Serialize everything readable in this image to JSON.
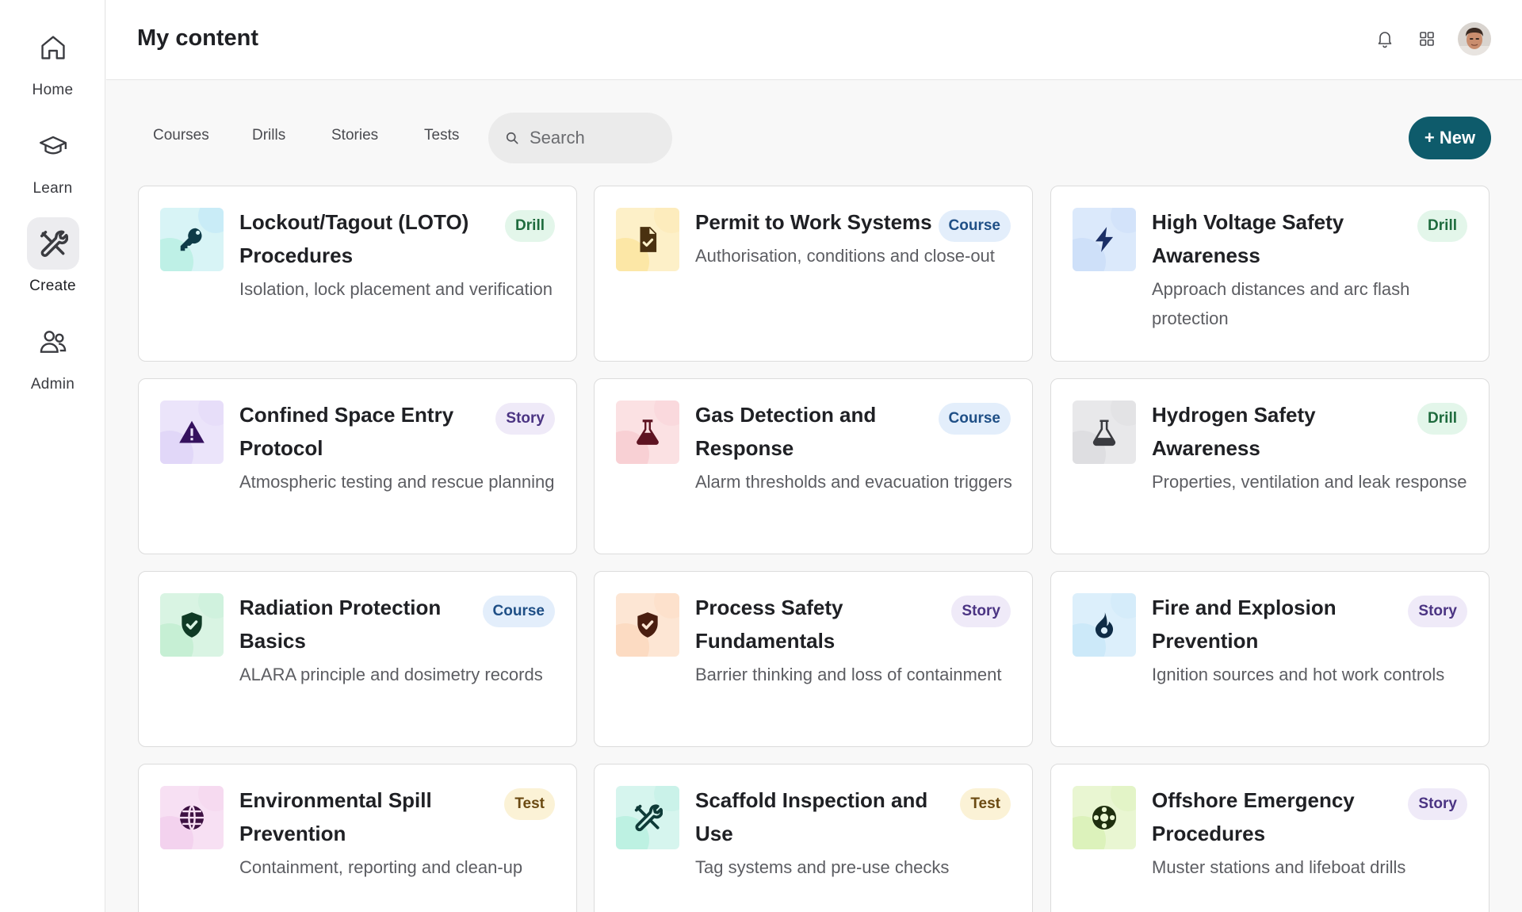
{
  "sidebar": {
    "items": [
      {
        "label": "Home",
        "icon": "home-icon",
        "active": false
      },
      {
        "label": "Learn",
        "icon": "graduation-cap-icon",
        "active": false
      },
      {
        "label": "Create",
        "icon": "tools-icon",
        "active": true
      },
      {
        "label": "Admin",
        "icon": "users-icon",
        "active": false
      }
    ]
  },
  "header": {
    "title": "My content",
    "icons": [
      "bell-icon",
      "grid-icon"
    ]
  },
  "toolbar": {
    "tabs": [
      "Courses",
      "Drills",
      "Stories",
      "Tests"
    ],
    "search_placeholder": "Search",
    "new_label": "+ New"
  },
  "colors": {
    "accent": "#0e5b6b",
    "drill": "#1e6b3d",
    "course": "#1f4f86",
    "story": "#4b3483",
    "test": "#6b4a12"
  },
  "cards": [
    {
      "title": "Lockout/Tagout (LOTO) Procedures",
      "desc": "Isolation, lock placement and verification",
      "badge": "Drill",
      "icon": "key-icon",
      "bg": "#d8f4f6",
      "blob1": "#a9ecd9",
      "blob2": "#b9e3f8",
      "fg": "#0f3b48"
    },
    {
      "title": "Permit to Work Systems",
      "desc": "Authorisation, conditions and close-out",
      "badge": "Course",
      "icon": "document-check-icon",
      "bg": "#fdf0c8",
      "blob1": "#fbe08a",
      "blob2": "#fde6b0",
      "fg": "#4a3110"
    },
    {
      "title": "High Voltage Safety Awareness",
      "desc": "Approach distances and arc flash protection",
      "badge": "Drill",
      "icon": "lightning-icon",
      "bg": "#dbe9fb",
      "blob1": "#c2d9f7",
      "blob2": "#c9dcf8",
      "fg": "#1b2f66"
    },
    {
      "title": "Confined Space Entry Protocol",
      "desc": "Atmospheric testing and rescue planning",
      "badge": "Story",
      "icon": "warning-icon",
      "bg": "#ebe4fa",
      "blob1": "#d8ccf6",
      "blob2": "#e2d6f8",
      "fg": "#35115e"
    },
    {
      "title": "Gas Detection and Response",
      "desc": "Alarm thresholds and evacuation triggers",
      "badge": "Course",
      "icon": "flask-icon",
      "bg": "#fbe1e3",
      "blob1": "#f6c3c8",
      "blob2": "#f9d0d4",
      "fg": "#5e1422"
    },
    {
      "title": "Hydrogen Safety Awareness",
      "desc": "Properties, ventilation and leak response",
      "badge": "Drill",
      "icon": "flask-icon",
      "bg": "#e8e8ea",
      "blob1": "#d5d5d8",
      "blob2": "#dddde0",
      "fg": "#3a3b40"
    },
    {
      "title": "Radiation Protection Basics",
      "desc": "ALARA principle and dosimetry records",
      "badge": "Course",
      "icon": "shield-check-icon",
      "bg": "#d9f4e3",
      "blob1": "#b6ebc9",
      "blob2": "#c6f0d6",
      "fg": "#0f3a25"
    },
    {
      "title": "Process Safety Fundamentals",
      "desc": "Barrier thinking and loss of containment",
      "badge": "Story",
      "icon": "shield-check-icon",
      "bg": "#fde6d4",
      "blob1": "#fbd2b3",
      "blob2": "#fcdcc3",
      "fg": "#4a1e10"
    },
    {
      "title": "Fire and Explosion Prevention",
      "desc": "Ignition sources and hot work controls",
      "badge": "Story",
      "icon": "flame-icon",
      "bg": "#dceffb",
      "blob1": "#bfe3f7",
      "blob2": "#cbe8f8",
      "fg": "#0f2c46"
    },
    {
      "title": "Environmental Spill Prevention",
      "desc": "Containment, reporting and clean-up",
      "badge": "Test",
      "icon": "globe-icon",
      "bg": "#f7e0f3",
      "blob1": "#f1c6ea",
      "blob2": "#f4d2ee",
      "fg": "#3d1142"
    },
    {
      "title": "Scaffold Inspection and Use",
      "desc": "Tag systems and pre-use checks",
      "badge": "Test",
      "icon": "tools-icon",
      "bg": "#d6f5ee",
      "blob1": "#a9ecd9",
      "blob2": "#bcefe2",
      "fg": "#0f3b38"
    },
    {
      "title": "Offshore Emergency Procedures",
      "desc": "Muster stations and lifeboat drills",
      "badge": "Story",
      "icon": "lifebuoy-icon",
      "bg": "#e9f6d2",
      "blob1": "#d2efa8",
      "blob2": "#dcf1bb",
      "fg": "#1f2f0f"
    }
  ]
}
